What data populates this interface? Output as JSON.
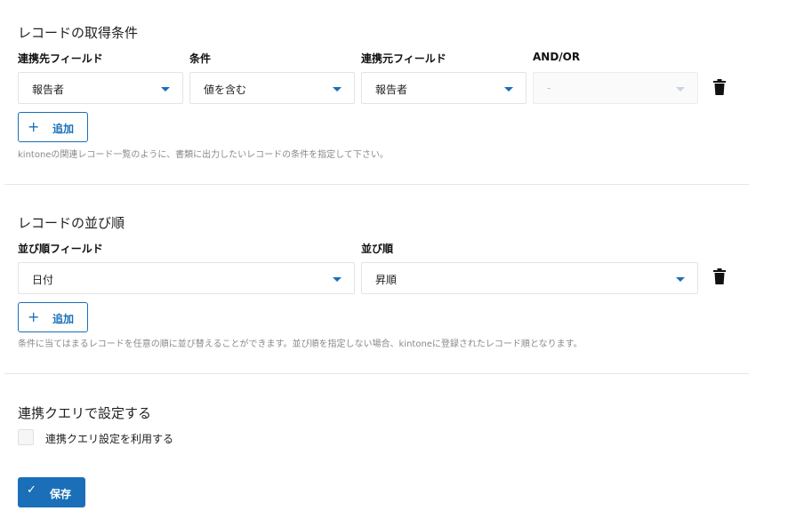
{
  "colors": {
    "accent": "#1a6fb8",
    "border": "#e3e3e3",
    "help_text": "#8a8a8a"
  },
  "record_conditions": {
    "title": "レコードの取得条件",
    "labels": {
      "dest_field": "連携先フィールド",
      "condition": "条件",
      "source_field": "連携元フィールド",
      "and_or": "AND/OR"
    },
    "rows": [
      {
        "dest_field": "報告者",
        "condition": "値を含む",
        "source_field": "報告者",
        "and_or": "-"
      }
    ],
    "add_label": "追加",
    "help": "kintoneの関連レコード一覧のように、書類に出力したいレコードの条件を指定して下さい。"
  },
  "record_order": {
    "title": "レコードの並び順",
    "labels": {
      "order_field": "並び順フィールド",
      "order": "並び順"
    },
    "rows": [
      {
        "order_field": "日付",
        "order": "昇順"
      }
    ],
    "add_label": "追加",
    "help": "条件に当てはまるレコードを任意の順に並び替えることができます。並び順を指定しない場合、kintoneに登録されたレコード順となります。"
  },
  "linked_query": {
    "title": "連携クエリで設定する",
    "checkbox_label": "連携クエリ設定を利用する",
    "checked": false
  },
  "save_label": "保存",
  "icons": [
    "plus-icon",
    "trash-icon",
    "caret-down-icon",
    "check-icon"
  ]
}
